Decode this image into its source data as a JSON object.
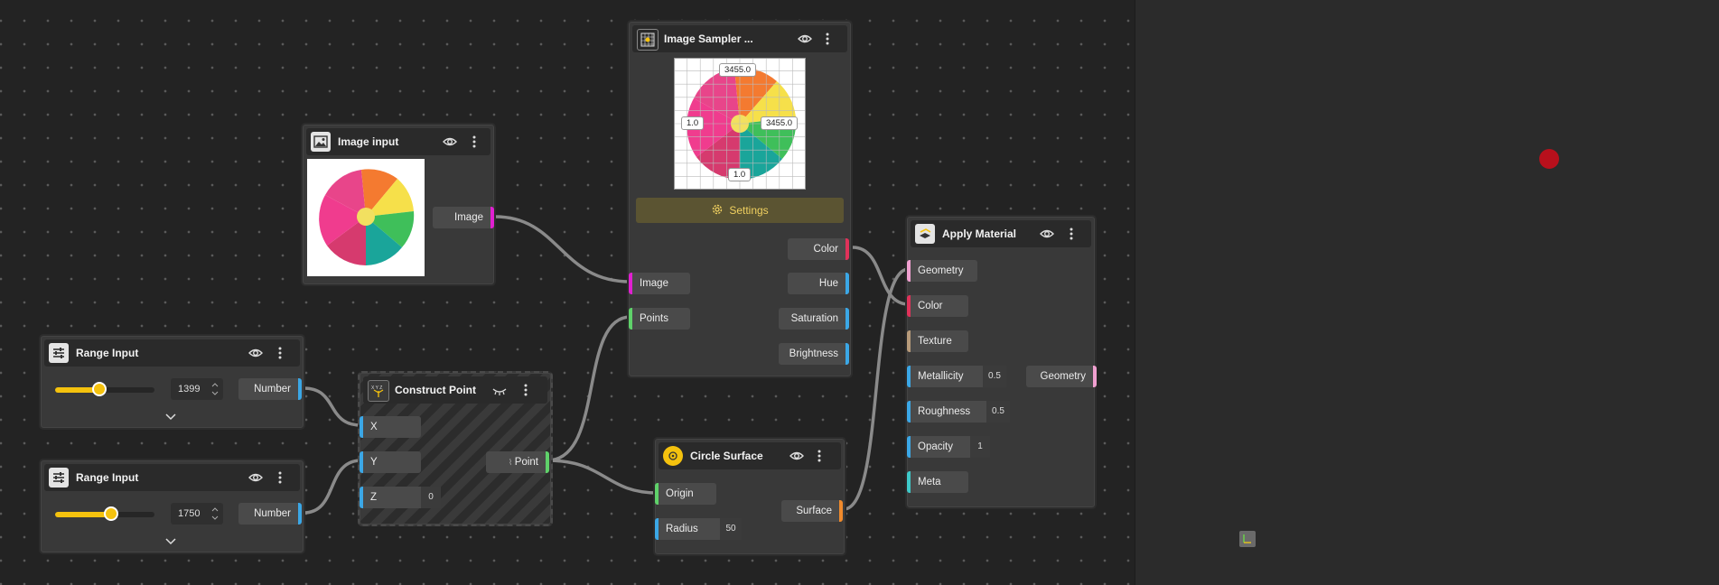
{
  "colors": {
    "accent": "#f5c20e",
    "image_port": "#e020d0",
    "number_port": "#3ba7e6",
    "point_port": "#5fd16a",
    "color_port": "#e0325a",
    "surface_port": "#f08a2c",
    "geometry_port": "#f0a0d0",
    "texture_port": "#b79a7a",
    "meta_port": "#3ec9c9",
    "marker": "#c0101e"
  },
  "image_input": {
    "title": "Image input",
    "output": "Image",
    "icon": "image-icon"
  },
  "range1": {
    "title": "Range Input",
    "value": "1399",
    "output": "Number",
    "level": 0.45,
    "icon": "sliders-icon"
  },
  "range2": {
    "title": "Range Input",
    "value": "1750",
    "output": "Number",
    "level": 0.57,
    "icon": "sliders-icon"
  },
  "construct": {
    "title": "Construct Point",
    "inputs": [
      "X",
      "Y",
      "Z"
    ],
    "z_value": "0",
    "output": "Point",
    "icon": "xyz-axes-icon"
  },
  "sampler": {
    "title": "Image Sampler ...",
    "top": "3455.0",
    "left": "1.0",
    "right": "3455.0",
    "bottom": "1.0",
    "settings": "Settings",
    "inputs": [
      "Image",
      "Points"
    ],
    "outputs": [
      "Color",
      "Hue",
      "Saturation",
      "Brightness"
    ],
    "icon": "grid-icon"
  },
  "circle": {
    "title": "Circle Surface",
    "inputs": [
      "Origin",
      "Radius"
    ],
    "radius_value": "50",
    "output": "Surface",
    "icon": "circle-icon"
  },
  "material": {
    "title": "Apply Material",
    "inputs": [
      "Geometry",
      "Color",
      "Texture",
      "Metallicity",
      "Roughness",
      "Opacity",
      "Meta"
    ],
    "metallicity_value": "0.5",
    "roughness_value": "0.5",
    "opacity_value": "1",
    "output": "Geometry",
    "icon": "material-icon"
  }
}
